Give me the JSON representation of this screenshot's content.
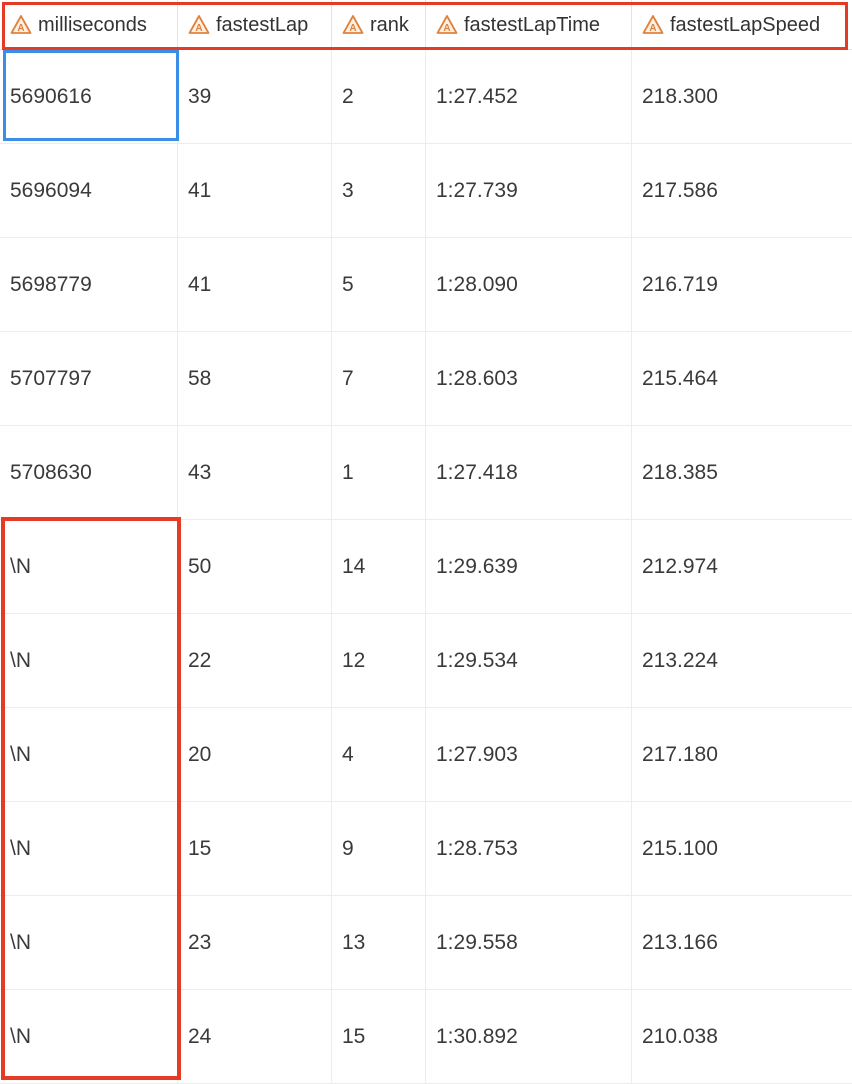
{
  "table": {
    "columns": [
      {
        "label": "milliseconds",
        "icon": "string-type-icon"
      },
      {
        "label": "fastestLap",
        "icon": "string-type-icon"
      },
      {
        "label": "rank",
        "icon": "string-type-icon"
      },
      {
        "label": "fastestLapTime",
        "icon": "string-type-icon"
      },
      {
        "label": "fastestLapSpeed",
        "icon": "string-type-icon"
      }
    ],
    "rows": [
      [
        "5690616",
        "39",
        "2",
        "1:27.452",
        "218.300"
      ],
      [
        "5696094",
        "41",
        "3",
        "1:27.739",
        "217.586"
      ],
      [
        "5698779",
        "41",
        "5",
        "1:28.090",
        "216.719"
      ],
      [
        "5707797",
        "58",
        "7",
        "1:28.603",
        "215.464"
      ],
      [
        "5708630",
        "43",
        "1",
        "1:27.418",
        "218.385"
      ],
      [
        "\\N",
        "50",
        "14",
        "1:29.639",
        "212.974"
      ],
      [
        "\\N",
        "22",
        "12",
        "1:29.534",
        "213.224"
      ],
      [
        "\\N",
        "20",
        "4",
        "1:27.903",
        "217.180"
      ],
      [
        "\\N",
        "15",
        "9",
        "1:28.753",
        "215.100"
      ],
      [
        "\\N",
        "23",
        "13",
        "1:29.558",
        "213.166"
      ],
      [
        "\\N",
        "24",
        "15",
        "1:30.892",
        "210.038"
      ]
    ]
  },
  "colors": {
    "icon_orange": "#e0823c",
    "highlight_red": "#e53a24",
    "selection_blue": "#3a8ee6"
  }
}
